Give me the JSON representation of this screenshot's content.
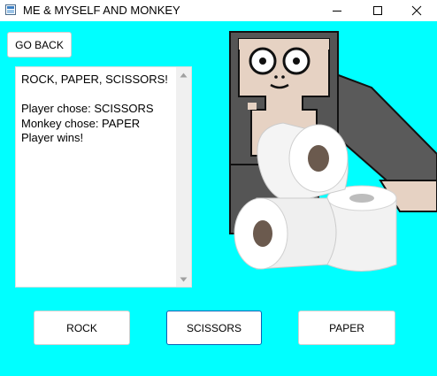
{
  "window": {
    "title": "ME & MYSELF AND MONKEY",
    "controls": {
      "minimize_icon": "minimize-icon",
      "maximize_icon": "maximize-icon",
      "close_icon": "close-icon"
    }
  },
  "toolbar": {
    "go_back_label": "GO BACK"
  },
  "game_log": {
    "lines": [
      "ROCK, PAPER, SCISSORS!",
      "",
      "Player chose: SCISSORS",
      "Monkey chose: PAPER",
      "Player wins!"
    ]
  },
  "choices": {
    "rock_label": "ROCK",
    "scissors_label": "SCISSORS",
    "paper_label": "PAPER"
  },
  "colors": {
    "background": "#00ffff",
    "button_background": "#ffffff",
    "focused_button_border": "#0a5fb4",
    "monkey_fur": "#555555",
    "monkey_face": "#e6d2c3"
  },
  "illustration": {
    "icon": "monkey-with-toilet-paper-icon"
  }
}
